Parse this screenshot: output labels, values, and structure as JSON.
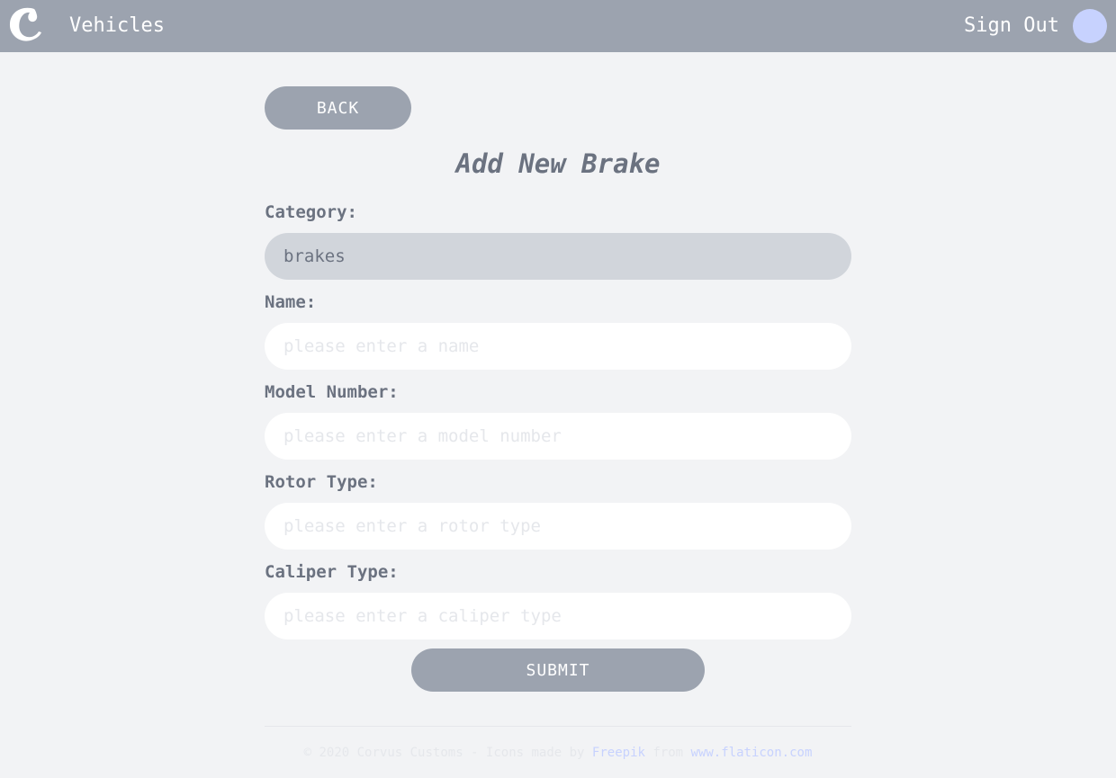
{
  "header": {
    "logo_icon": "corvus-c-logo-icon",
    "nav_label": "Vehicles",
    "signout_label": "Sign Out",
    "avatar_color": "#c7d2fe",
    "bar_color": "#9ca3af"
  },
  "page": {
    "back_label": "BACK",
    "title": "Add New Brake",
    "submit_label": "SUBMIT"
  },
  "form": {
    "category": {
      "label": "Category:",
      "value": "brakes"
    },
    "name": {
      "label": "Name:",
      "placeholder": "please enter a name"
    },
    "model_number": {
      "label": "Model Number:",
      "placeholder": "please enter a model number"
    },
    "rotor_type": {
      "label": "Rotor Type:",
      "placeholder": "please enter a rotor type"
    },
    "caliper_type": {
      "label": "Caliper Type:",
      "placeholder": "please enter a caliper type"
    }
  },
  "footer": {
    "prefix": "© 2020 Corvus Customs - Icons made by ",
    "link1": "Freepik",
    "middle": " from ",
    "link2": "www.flaticon.com"
  }
}
